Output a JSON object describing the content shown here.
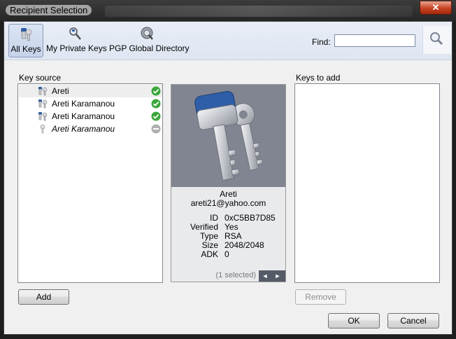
{
  "window": {
    "title": "Recipient Selection",
    "close_label": "✕"
  },
  "toolbar": {
    "buttons": [
      {
        "label": "All Keys"
      },
      {
        "label": "My Private Keys"
      },
      {
        "label": "PGP Global Directory"
      }
    ],
    "find_label": "Find:",
    "find_value": ""
  },
  "key_source": {
    "label": "Key source",
    "rows": [
      {
        "name": "Areti",
        "status": "valid"
      },
      {
        "name": "Areti Karamanou",
        "status": "valid"
      },
      {
        "name": "Areti Karamanou",
        "status": "valid"
      },
      {
        "name": "Areti Karamanou",
        "status": "invalid"
      }
    ]
  },
  "details": {
    "name": "Areti",
    "email": "areti21@yahoo.com",
    "fields": [
      {
        "key": "ID",
        "value": "0xC5BB7D85"
      },
      {
        "key": "Verified",
        "value": "Yes"
      },
      {
        "key": "Type",
        "value": "RSA"
      },
      {
        "key": "Size",
        "value": "2048/2048"
      },
      {
        "key": "ADK",
        "value": "0"
      }
    ],
    "selection_text": "(1 selected)",
    "prev": "◄",
    "next": "►"
  },
  "keys_to_add": {
    "label": "Keys to add"
  },
  "buttons": {
    "add": "Add",
    "remove": "Remove",
    "ok": "OK",
    "cancel": "Cancel"
  },
  "colors": {
    "valid": "#3aa63a",
    "invalid": "#b0b0b0",
    "key_blue": "#2f5ea8"
  }
}
